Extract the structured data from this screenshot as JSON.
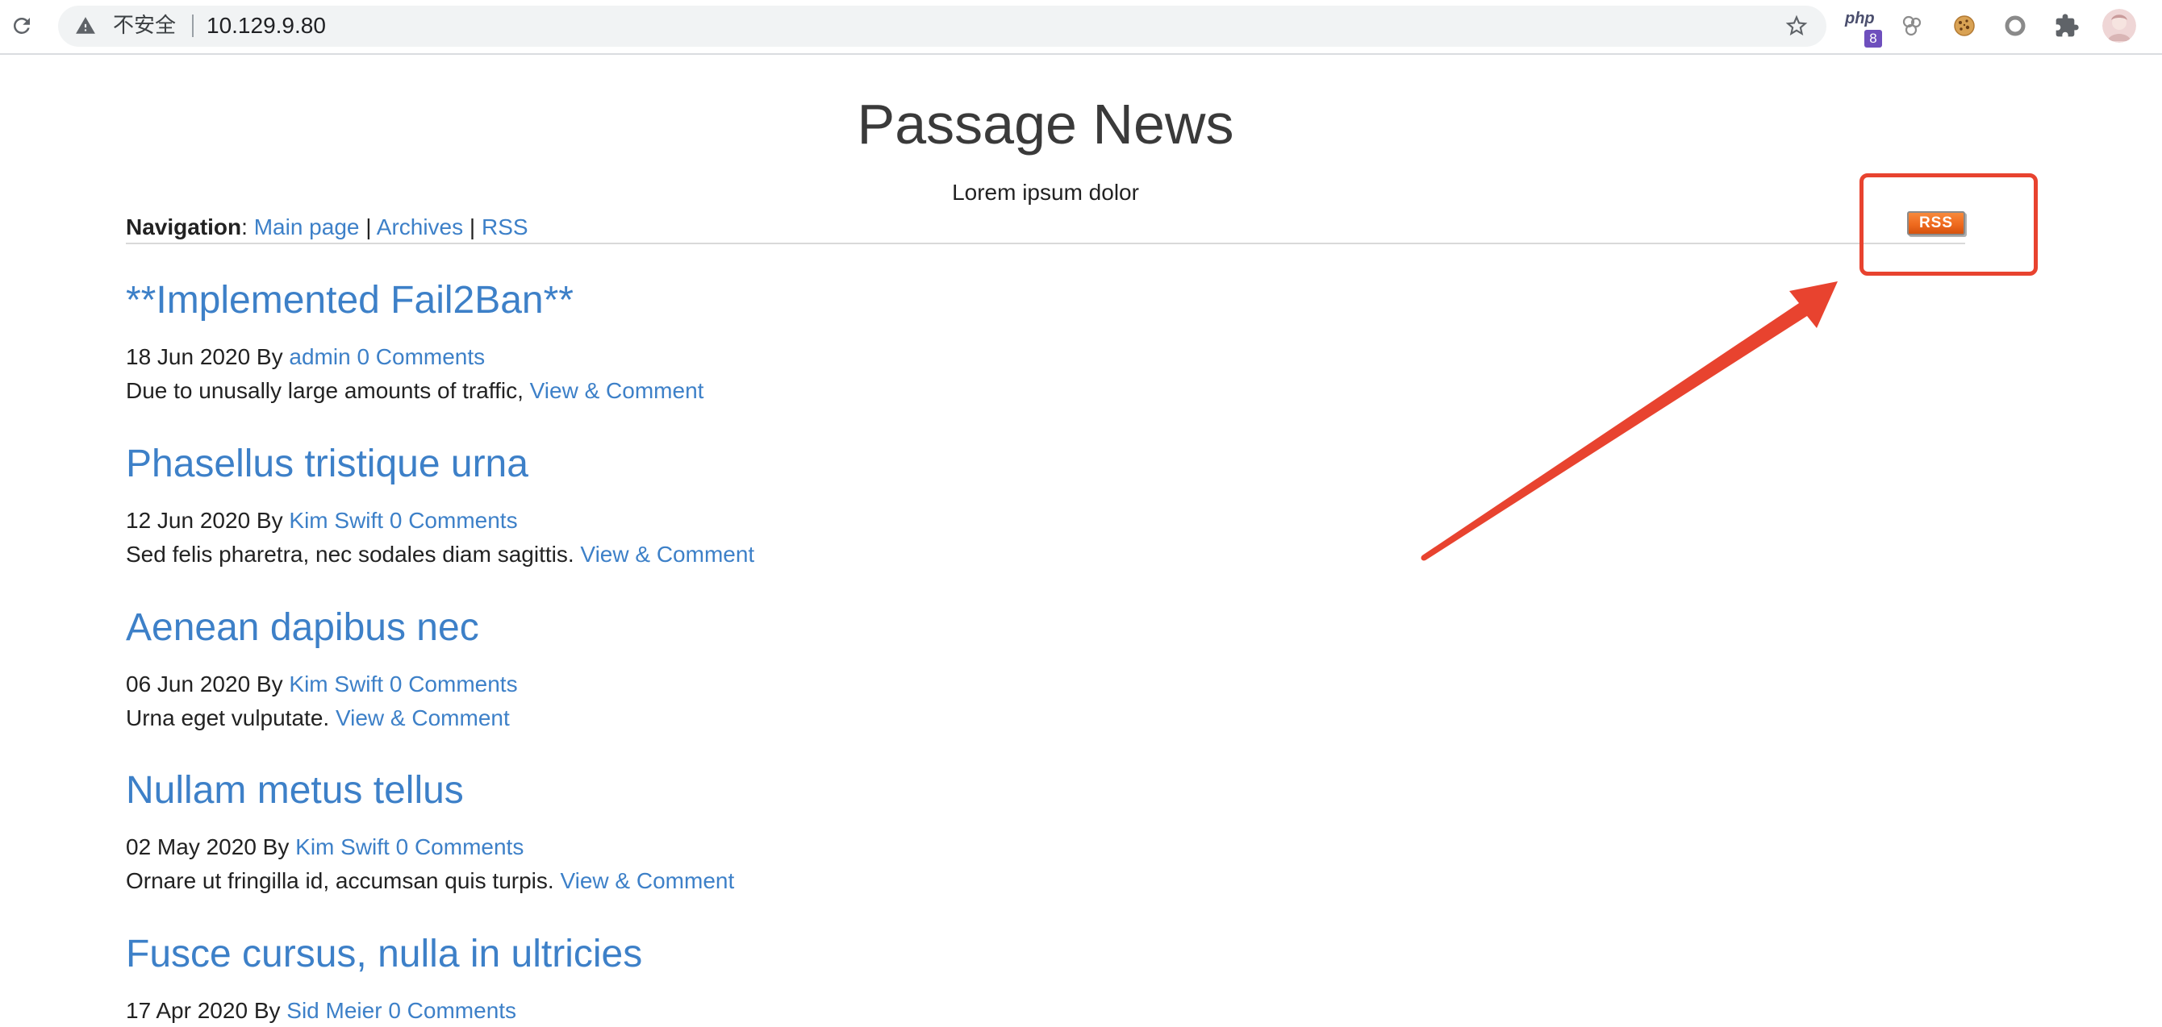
{
  "browser": {
    "security_label": "不安全",
    "url": "10.129.9.80",
    "icons": [
      "reload-icon",
      "warning-icon",
      "star-icon"
    ],
    "extensions": [
      {
        "icon": "php-version-icon",
        "label": "php",
        "badge": "8"
      },
      {
        "icon": "linked-nodes-icon"
      },
      {
        "icon": "cookie-icon"
      },
      {
        "icon": "ring-icon"
      },
      {
        "icon": "puzzle-icon"
      },
      {
        "icon": "profile-avatar-icon"
      }
    ]
  },
  "site": {
    "title": "Passage News",
    "tagline": "Lorem ipsum dolor"
  },
  "nav": {
    "label": "Navigation",
    "label_suffix": ":",
    "separator": "|",
    "links": [
      {
        "label": "Main page"
      },
      {
        "label": "Archives"
      },
      {
        "label": "RSS"
      }
    ]
  },
  "rss_badge": {
    "label": "RSS"
  },
  "post_meta": {
    "by_label": "By"
  },
  "posts": [
    {
      "title": "**Implemented Fail2Ban**",
      "date": "18 Jun 2020",
      "author": "admin",
      "comments": "0 Comments",
      "excerpt": "Due to unusally large amounts of traffic,",
      "link_label": "View & Comment"
    },
    {
      "title": "Phasellus tristique urna",
      "date": "12 Jun 2020",
      "author": "Kim Swift",
      "comments": "0 Comments",
      "excerpt": "Sed felis pharetra, nec sodales diam sagittis.",
      "link_label": "View & Comment"
    },
    {
      "title": "Aenean dapibus nec",
      "date": "06 Jun 2020",
      "author": "Kim Swift",
      "comments": "0 Comments",
      "excerpt": "Urna eget vulputate.",
      "link_label": "View & Comment"
    },
    {
      "title": "Nullam metus tellus",
      "date": "02 May 2020",
      "author": "Kim Swift",
      "comments": "0 Comments",
      "excerpt": "Ornare ut fringilla id, accumsan quis turpis.",
      "link_label": "View & Comment"
    },
    {
      "title": "Fusce cursus, nulla in ultricies",
      "date": "17 Apr 2020",
      "author": "Sid Meier",
      "comments": "0 Comments"
    }
  ],
  "theme": {
    "link_color": "#3d80c8",
    "text_color": "#222222",
    "annotation_color": "#e8432f",
    "rss_badge_color": "#ef6a1e",
    "address_bar_color": "#f1f3f4"
  }
}
